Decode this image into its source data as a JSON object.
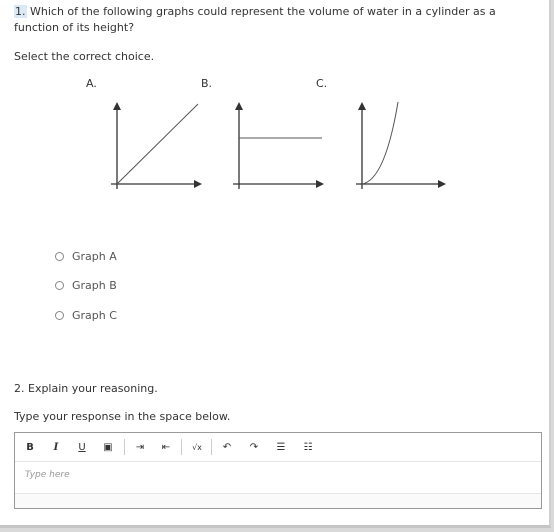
{
  "question1": {
    "number": "1.",
    "text": " Which of the following graphs could represent the volume of water in a cylinder as a function of its height?",
    "instruction": "Select the correct choice.",
    "graphs": [
      {
        "label": "A.",
        "shape": "linear increasing line through origin"
      },
      {
        "label": "B.",
        "shape": "horizontal constant line"
      },
      {
        "label": "C.",
        "shape": "curve increasing, concave up from origin"
      }
    ],
    "choices": [
      {
        "label": "Graph A",
        "selected": false
      },
      {
        "label": "Graph B",
        "selected": false
      },
      {
        "label": "Graph C",
        "selected": false
      }
    ]
  },
  "question2": {
    "text": "2. Explain your reasoning.",
    "instruction": "Type your response in the space below.",
    "editor": {
      "placeholder": "Type here",
      "toolbar": [
        {
          "name": "bold",
          "glyph": "B"
        },
        {
          "name": "italic",
          "glyph": "I"
        },
        {
          "name": "underline",
          "glyph": "U"
        },
        {
          "name": "image",
          "glyph": "▣"
        },
        {
          "name": "indent",
          "glyph": "⇥"
        },
        {
          "name": "outdent",
          "glyph": "⇤"
        },
        {
          "name": "math",
          "glyph": "√x"
        },
        {
          "name": "undo",
          "glyph": "↶"
        },
        {
          "name": "redo",
          "glyph": "↷"
        },
        {
          "name": "bullet-list",
          "glyph": "☰"
        },
        {
          "name": "numbered-list",
          "glyph": "☷"
        }
      ]
    }
  }
}
